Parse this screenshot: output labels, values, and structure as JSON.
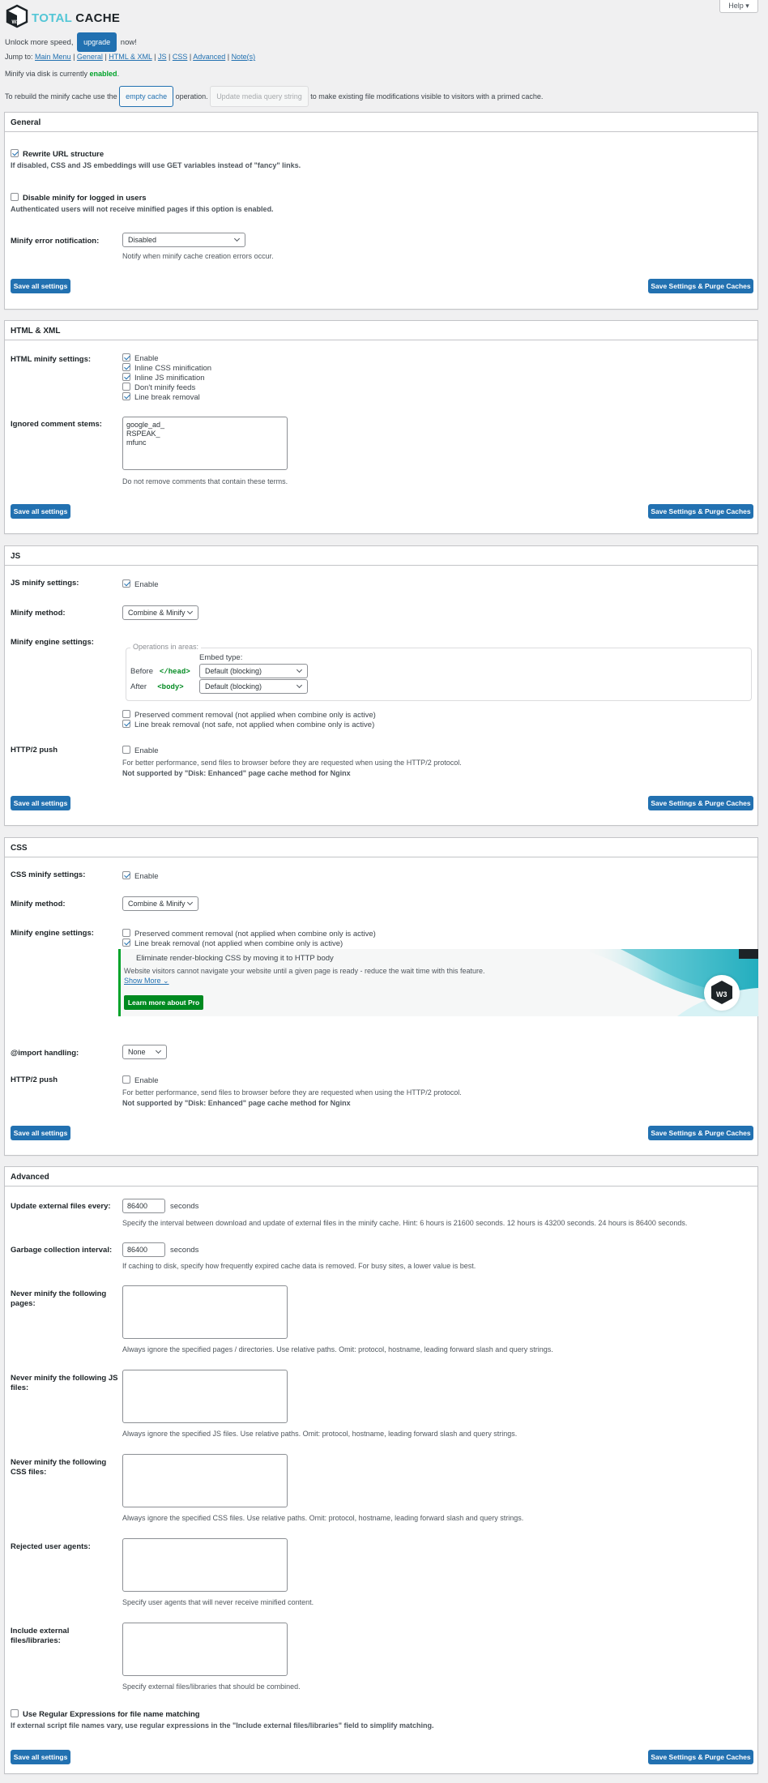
{
  "brand": {
    "logo_mark": "W3",
    "name_part1": "TOTAL",
    "name_part2": " CACHE"
  },
  "help": {
    "label": "Help ▾"
  },
  "upsell": {
    "prefix": "Unlock more speed,",
    "button": "upgrade",
    "suffix": "now!"
  },
  "jump": {
    "prefix": "Jump to:",
    "links": [
      "Main Menu",
      "General",
      "HTML & XML",
      "JS",
      "CSS",
      "Advanced",
      "Note(s)"
    ]
  },
  "status": {
    "prefix": "Minify via disk is currently",
    "state": "enabled",
    "suffix": "."
  },
  "rebuild": {
    "prefix": "To rebuild the minify cache use the",
    "empty_button": "empty cache",
    "middle": "operation.",
    "update_button": "Update media query string",
    "suffix": "to make existing file modifications visible to visitors with a primed cache."
  },
  "buttons": {
    "save_all": "Save all settings",
    "save_purge": "Save Settings & Purge Caches"
  },
  "general": {
    "title": "General",
    "rewrite_label": "Rewrite URL structure",
    "rewrite_checked": true,
    "rewrite_desc": "If disabled, CSS and JS embeddings will use GET variables instead of \"fancy\" links.",
    "disable_label": "Disable minify for logged in users",
    "disable_checked": false,
    "disable_desc": "Authenticated users will not receive minified pages if this option is enabled.",
    "error_label": "Minify error notification:",
    "error_value": "Disabled",
    "error_desc": "Notify when minify cache creation errors occur."
  },
  "html": {
    "title": "HTML & XML",
    "settings_label": "HTML minify settings:",
    "options": [
      {
        "label": "Enable",
        "checked": true
      },
      {
        "label": "Inline CSS minification",
        "checked": true
      },
      {
        "label": "Inline JS minification",
        "checked": true
      },
      {
        "label": "Don't minify feeds",
        "checked": false
      },
      {
        "label": "Line break removal",
        "checked": true
      }
    ],
    "ignored_label": "Ignored comment stems:",
    "ignored_value": "google_ad_\nRSPEAK_\nmfunc",
    "ignored_desc": "Do not remove comments that contain these terms."
  },
  "js": {
    "title": "JS",
    "settings_label": "JS minify settings:",
    "enable": "Enable",
    "enable_checked": true,
    "method_label": "Minify method:",
    "method_value": "Combine & Minify",
    "engine_label": "Minify engine settings:",
    "legend": "Operations in areas:",
    "embed_label": "Embed type:",
    "before_label": "Before",
    "before_tag": "</head>",
    "before_value": "Default (blocking)",
    "after_label": "After",
    "after_tag": "<body>",
    "after_value": "Default (blocking)",
    "preserve_label": "Preserved comment removal (not applied when combine only is active)",
    "preserve_checked": false,
    "linebreak_label": "Line break removal (not safe, not applied when combine only is active)",
    "linebreak_checked": true,
    "http2_label": "HTTP/2 push",
    "http2_enable": "Enable",
    "http2_checked": false,
    "http2_desc": "For better performance, send files to browser before they are requested when using the HTTP/2 protocol.",
    "http2_note": "Not supported by \"Disk: Enhanced\" page cache method for Nginx"
  },
  "css": {
    "title": "CSS",
    "settings_label": "CSS minify settings:",
    "enable": "Enable",
    "enable_checked": true,
    "method_label": "Minify method:",
    "method_value": "Combine & Minify",
    "engine_label": "Minify engine settings:",
    "preserve_label": "Preserved comment removal (not applied when combine only is active)",
    "preserve_checked": false,
    "linebreak_label": "Line break removal (not applied when combine only is active)",
    "linebreak_checked": true,
    "promo_title": "Eliminate render-blocking CSS by moving it to HTTP body",
    "promo_desc": "Website visitors cannot navigate your website until a given page is ready - reduce the wait time with this feature.",
    "promo_more": "Show More ⌄",
    "promo_button": "Learn more about Pro",
    "promo_badge": "W3",
    "import_label": "@import handling:",
    "import_value": "None",
    "http2_label": "HTTP/2 push",
    "http2_enable": "Enable",
    "http2_checked": false,
    "http2_desc": "For better performance, send files to browser before they are requested when using the HTTP/2 protocol.",
    "http2_note": "Not supported by \"Disk: Enhanced\" page cache method for Nginx"
  },
  "advanced": {
    "title": "Advanced",
    "update_label": "Update external files every:",
    "update_value": "86400",
    "update_unit": "seconds",
    "update_desc": "Specify the interval between download and update of external files in the minify cache. Hint: 6 hours is 21600 seconds. 12 hours is 43200 seconds. 24 hours is 86400 seconds.",
    "gc_label": "Garbage collection interval:",
    "gc_value": "86400",
    "gc_unit": "seconds",
    "gc_desc": "If caching to disk, specify how frequently expired cache data is removed. For busy sites, a lower value is best.",
    "pages_label_1": "Never minify the following",
    "pages_label_2": "pages:",
    "pages_desc": "Always ignore the specified pages / directories. Use relative paths. Omit: protocol, hostname, leading forward slash and query strings.",
    "js_label_1": "Never minify the following JS",
    "js_label_2": "files:",
    "js_desc": "Always ignore the specified JS files. Use relative paths. Omit: protocol, hostname, leading forward slash and query strings.",
    "css_label_1": "Never minify the following",
    "css_label_2": "CSS files:",
    "css_desc": "Always ignore the specified CSS files. Use relative paths. Omit: protocol, hostname, leading forward slash and query strings.",
    "agents_label": "Rejected user agents:",
    "agents_desc": "Specify user agents that will never receive minified content.",
    "include_label_1": "Include external",
    "include_label_2": "files/libraries:",
    "include_desc": "Specify external files/libraries that should be combined.",
    "regex_label": "Use Regular Expressions for file name matching",
    "regex_checked": false,
    "regex_desc": "If external script file names vary, use regular expressions in the \"Include external files/libraries\" field to simplify matching."
  }
}
